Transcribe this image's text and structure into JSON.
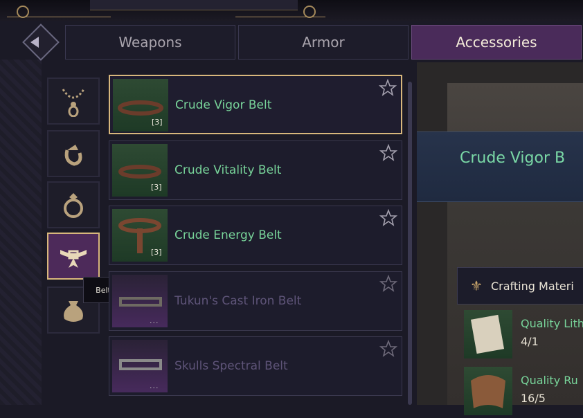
{
  "tabs": [
    {
      "label": "Weapons",
      "active": false
    },
    {
      "label": "Armor",
      "active": false
    },
    {
      "label": "Accessories",
      "active": true
    }
  ],
  "categories": [
    {
      "icon": "necklace-icon",
      "active": false
    },
    {
      "icon": "earring-icon",
      "active": false
    },
    {
      "icon": "ring-icon",
      "active": false
    },
    {
      "icon": "belt-icon",
      "active": true
    },
    {
      "icon": "pouch-icon",
      "active": false
    }
  ],
  "tooltip": {
    "text": "Belt"
  },
  "items": [
    {
      "name": "Crude Vigor Belt",
      "tier": "[3]",
      "rarity": "green",
      "selected": true
    },
    {
      "name": "Crude Vitality Belt",
      "tier": "[3]",
      "rarity": "green",
      "selected": false
    },
    {
      "name": "Crude Energy Belt",
      "tier": "[3]",
      "rarity": "green",
      "selected": false
    },
    {
      "name": "Tukun's Cast Iron Belt",
      "tier": "...",
      "rarity": "purple",
      "selected": false
    },
    {
      "name": "Skulls Spectral Belt",
      "tier": "...",
      "rarity": "purple",
      "selected": false
    }
  ],
  "detail": {
    "title": "Crude Vigor B",
    "materials_header": "Crafting Materi",
    "materials": [
      {
        "name": "Quality Lith",
        "qty": "4/1"
      },
      {
        "name": "Quality Ru",
        "qty": "16/5"
      }
    ]
  },
  "colors": {
    "accent_gold": "#d8b77c",
    "active_tab": "#4a2b5a",
    "uncommon_green": "#78d49a",
    "rare_purple": "#5e5478"
  }
}
